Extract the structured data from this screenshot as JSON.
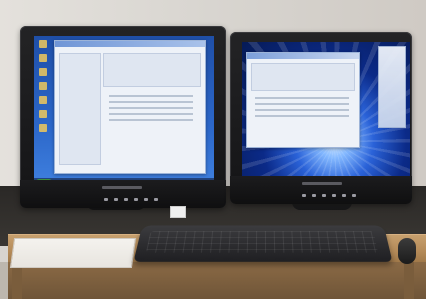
{
  "scene": {
    "description_text": "",
    "objects": {
      "left_monitor": "monitor",
      "right_monitor": "monitor",
      "keyboard": "keyboard",
      "desk": "desk"
    }
  },
  "colors": {
    "wall": "#d8d4cf",
    "desk": "#b48a58",
    "bezel": "#141416",
    "left_wallpaper": "#2c67c9",
    "right_wallpaper": "#0b2a88"
  },
  "icons": {
    "desktop_icon": "desktop-shortcut-icon",
    "start": "start-button-icon",
    "gadget": "sidebar-gadget-icon"
  }
}
